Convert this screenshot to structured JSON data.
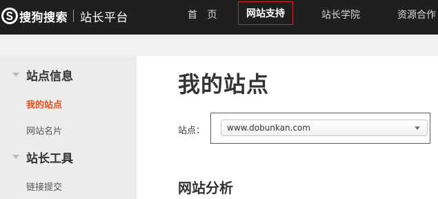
{
  "header": {
    "brand": "搜狗搜索",
    "subtitle": "站长平台",
    "nav": {
      "home": "首 页",
      "support": "网站支持",
      "academy": "站长学院",
      "resources": "资源合作"
    }
  },
  "sidebar": {
    "groups": [
      {
        "label": "站点信息",
        "items": [
          "我的站点",
          "网站名片"
        ]
      },
      {
        "label": "站长工具",
        "items": [
          "链接提交"
        ]
      }
    ]
  },
  "main": {
    "title": "我的站点",
    "site_label": "站点：",
    "site_select": {
      "value": "www.dobunkan.com"
    },
    "section_title": "网站分析"
  },
  "colors": {
    "header_bg": "#1f1f1f",
    "accent_red": "#d6252a",
    "active_orange": "#e0521f"
  }
}
